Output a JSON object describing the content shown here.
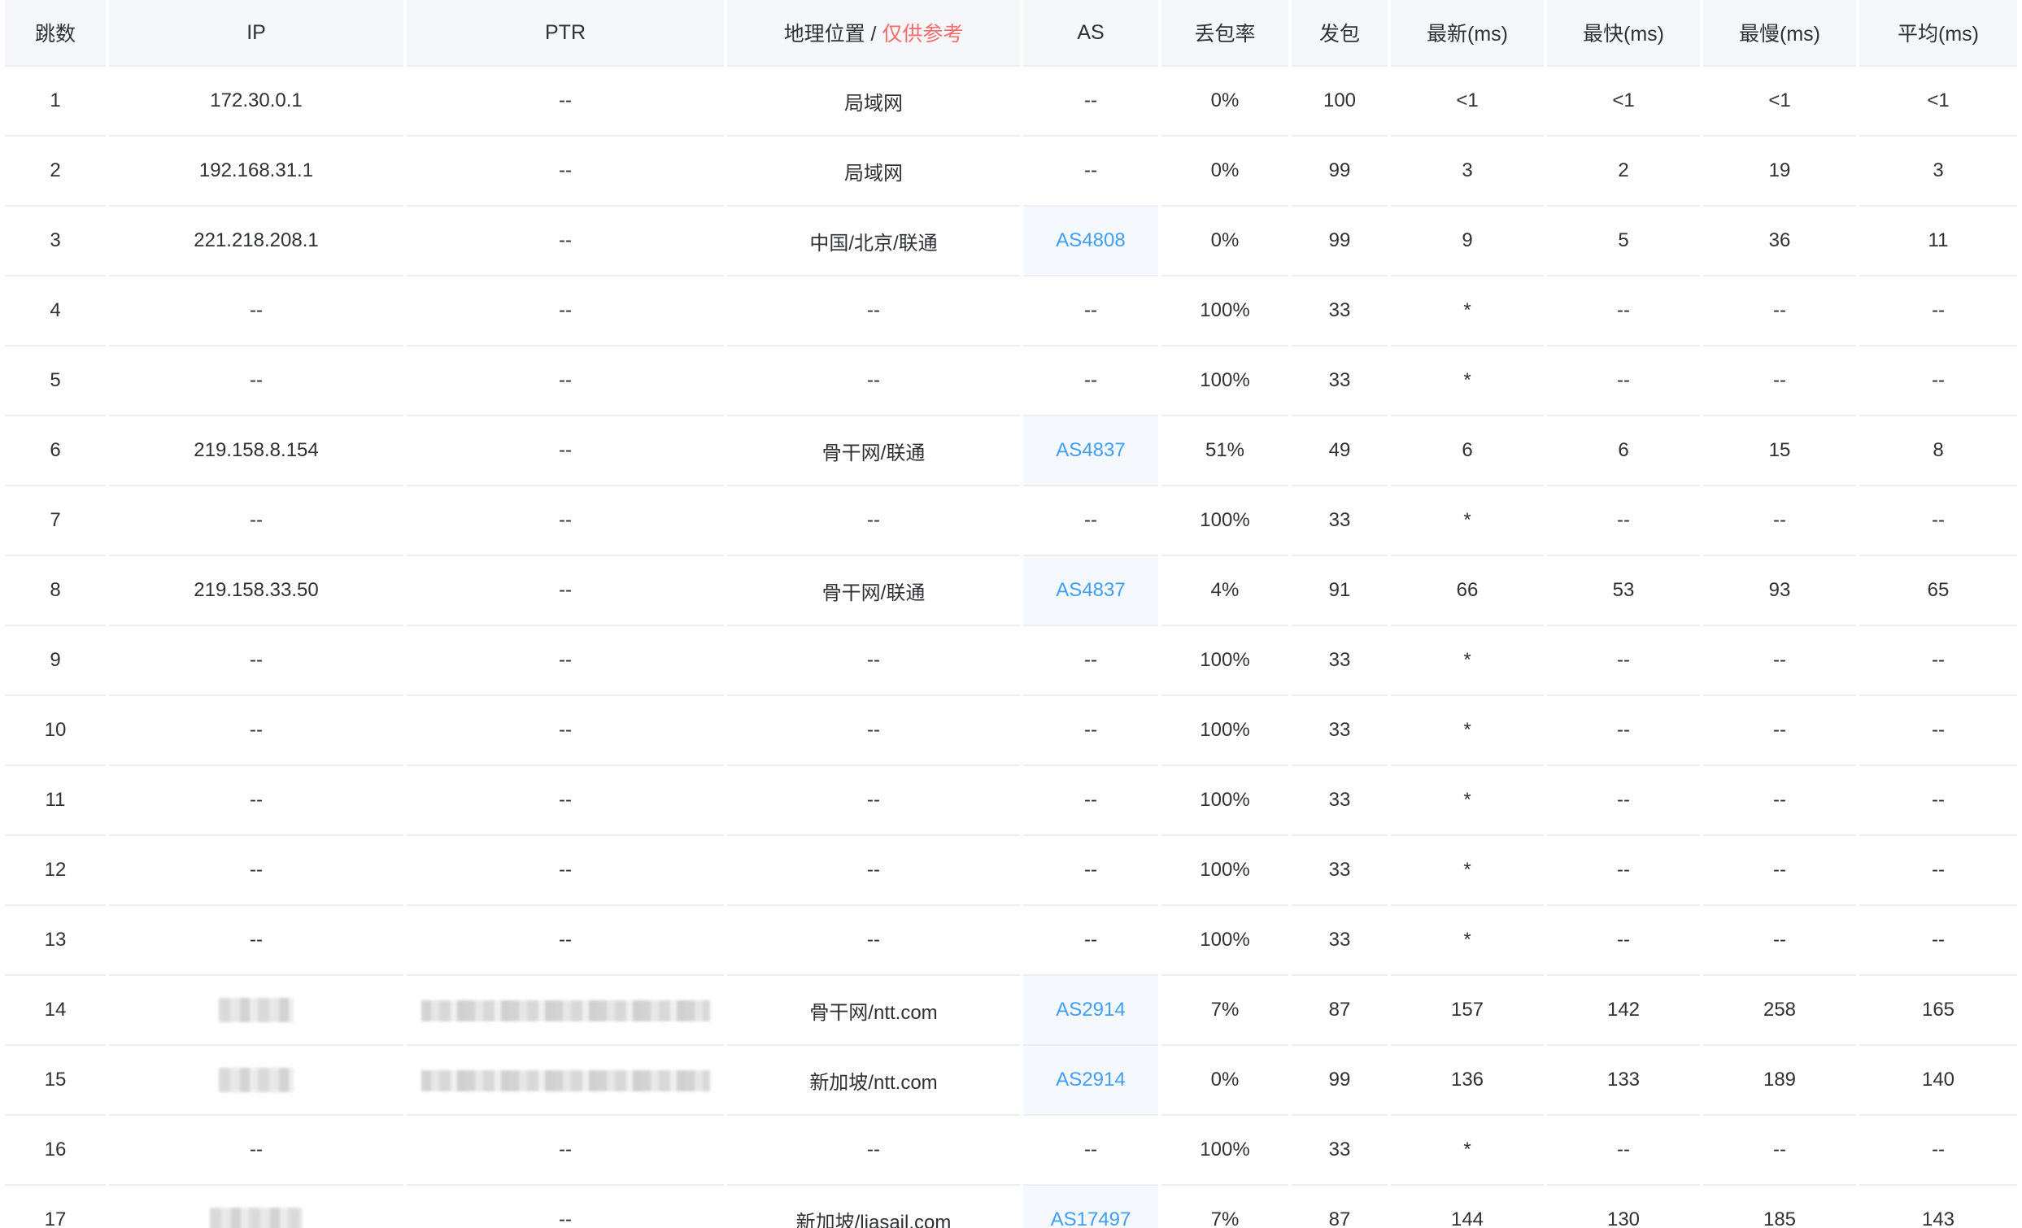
{
  "header": {
    "hop": "跳数",
    "ip": "IP",
    "ptr": "PTR",
    "geo": "地理位置 / ",
    "geo_note": "仅供参考",
    "as": "AS",
    "loss": "丢包率",
    "sent": "发包",
    "last": "最新(ms)",
    "best": "最快(ms)",
    "worst": "最慢(ms)",
    "avg": "平均(ms)"
  },
  "rows": [
    {
      "hop": "1",
      "ip": "172.30.0.1",
      "ptr": "--",
      "geo": "局域网",
      "as": "--",
      "loss": "0%",
      "sent": "100",
      "last": "<1",
      "best": "<1",
      "worst": "<1",
      "avg": "<1"
    },
    {
      "hop": "2",
      "ip": "192.168.31.1",
      "ptr": "--",
      "geo": "局域网",
      "as": "--",
      "loss": "0%",
      "sent": "99",
      "last": "3",
      "best": "2",
      "worst": "19",
      "avg": "3"
    },
    {
      "hop": "3",
      "ip": "221.218.208.1",
      "ptr": "--",
      "geo": "中国/北京/联通",
      "as": "AS4808",
      "loss": "0%",
      "sent": "99",
      "last": "9",
      "best": "5",
      "worst": "36",
      "avg": "11"
    },
    {
      "hop": "4",
      "ip": "--",
      "ptr": "--",
      "geo": "--",
      "as": "--",
      "loss": "100%",
      "sent": "33",
      "last": "*",
      "best": "--",
      "worst": "--",
      "avg": "--"
    },
    {
      "hop": "5",
      "ip": "--",
      "ptr": "--",
      "geo": "--",
      "as": "--",
      "loss": "100%",
      "sent": "33",
      "last": "*",
      "best": "--",
      "worst": "--",
      "avg": "--"
    },
    {
      "hop": "6",
      "ip": "219.158.8.154",
      "ptr": "--",
      "geo": "骨干网/联通",
      "as": "AS4837",
      "loss": "51%",
      "sent": "49",
      "last": "6",
      "best": "6",
      "worst": "15",
      "avg": "8"
    },
    {
      "hop": "7",
      "ip": "--",
      "ptr": "--",
      "geo": "--",
      "as": "--",
      "loss": "100%",
      "sent": "33",
      "last": "*",
      "best": "--",
      "worst": "--",
      "avg": "--"
    },
    {
      "hop": "8",
      "ip": "219.158.33.50",
      "ptr": "--",
      "geo": "骨干网/联通",
      "as": "AS4837",
      "loss": "4%",
      "sent": "91",
      "last": "66",
      "best": "53",
      "worst": "93",
      "avg": "65"
    },
    {
      "hop": "9",
      "ip": "--",
      "ptr": "--",
      "geo": "--",
      "as": "--",
      "loss": "100%",
      "sent": "33",
      "last": "*",
      "best": "--",
      "worst": "--",
      "avg": "--"
    },
    {
      "hop": "10",
      "ip": "--",
      "ptr": "--",
      "geo": "--",
      "as": "--",
      "loss": "100%",
      "sent": "33",
      "last": "*",
      "best": "--",
      "worst": "--",
      "avg": "--"
    },
    {
      "hop": "11",
      "ip": "--",
      "ptr": "--",
      "geo": "--",
      "as": "--",
      "loss": "100%",
      "sent": "33",
      "last": "*",
      "best": "--",
      "worst": "--",
      "avg": "--"
    },
    {
      "hop": "12",
      "ip": "--",
      "ptr": "--",
      "geo": "--",
      "as": "--",
      "loss": "100%",
      "sent": "33",
      "last": "*",
      "best": "--",
      "worst": "--",
      "avg": "--"
    },
    {
      "hop": "13",
      "ip": "--",
      "ptr": "--",
      "geo": "--",
      "as": "--",
      "loss": "100%",
      "sent": "33",
      "last": "*",
      "best": "--",
      "worst": "--",
      "avg": "--"
    },
    {
      "hop": "14",
      "ip_blurred": true,
      "ptr_blurred": true,
      "geo": "骨干网/ntt.com",
      "as": "AS2914",
      "loss": "7%",
      "sent": "87",
      "last": "157",
      "best": "142",
      "worst": "258",
      "avg": "165"
    },
    {
      "hop": "15",
      "ip_blurred": true,
      "ptr_blurred": true,
      "geo": "新加坡/ntt.com",
      "as": "AS2914",
      "loss": "0%",
      "sent": "99",
      "last": "136",
      "best": "133",
      "worst": "189",
      "avg": "140"
    },
    {
      "hop": "16",
      "ip": "--",
      "ptr": "--",
      "geo": "--",
      "as": "--",
      "loss": "100%",
      "sent": "33",
      "last": "*",
      "best": "--",
      "worst": "--",
      "avg": "--"
    },
    {
      "hop": "17",
      "ip_blurred": true,
      "ptr": "--",
      "geo": "新加坡/liasail.com",
      "as": "AS17497",
      "loss": "7%",
      "sent": "87",
      "last": "144",
      "best": "130",
      "worst": "185",
      "avg": "143"
    }
  ],
  "colors": {
    "header_bg": "#f5f7fa",
    "border": "#ebeef5",
    "text": "#303133",
    "link": "#409eff",
    "warning": "#f56c6c"
  }
}
